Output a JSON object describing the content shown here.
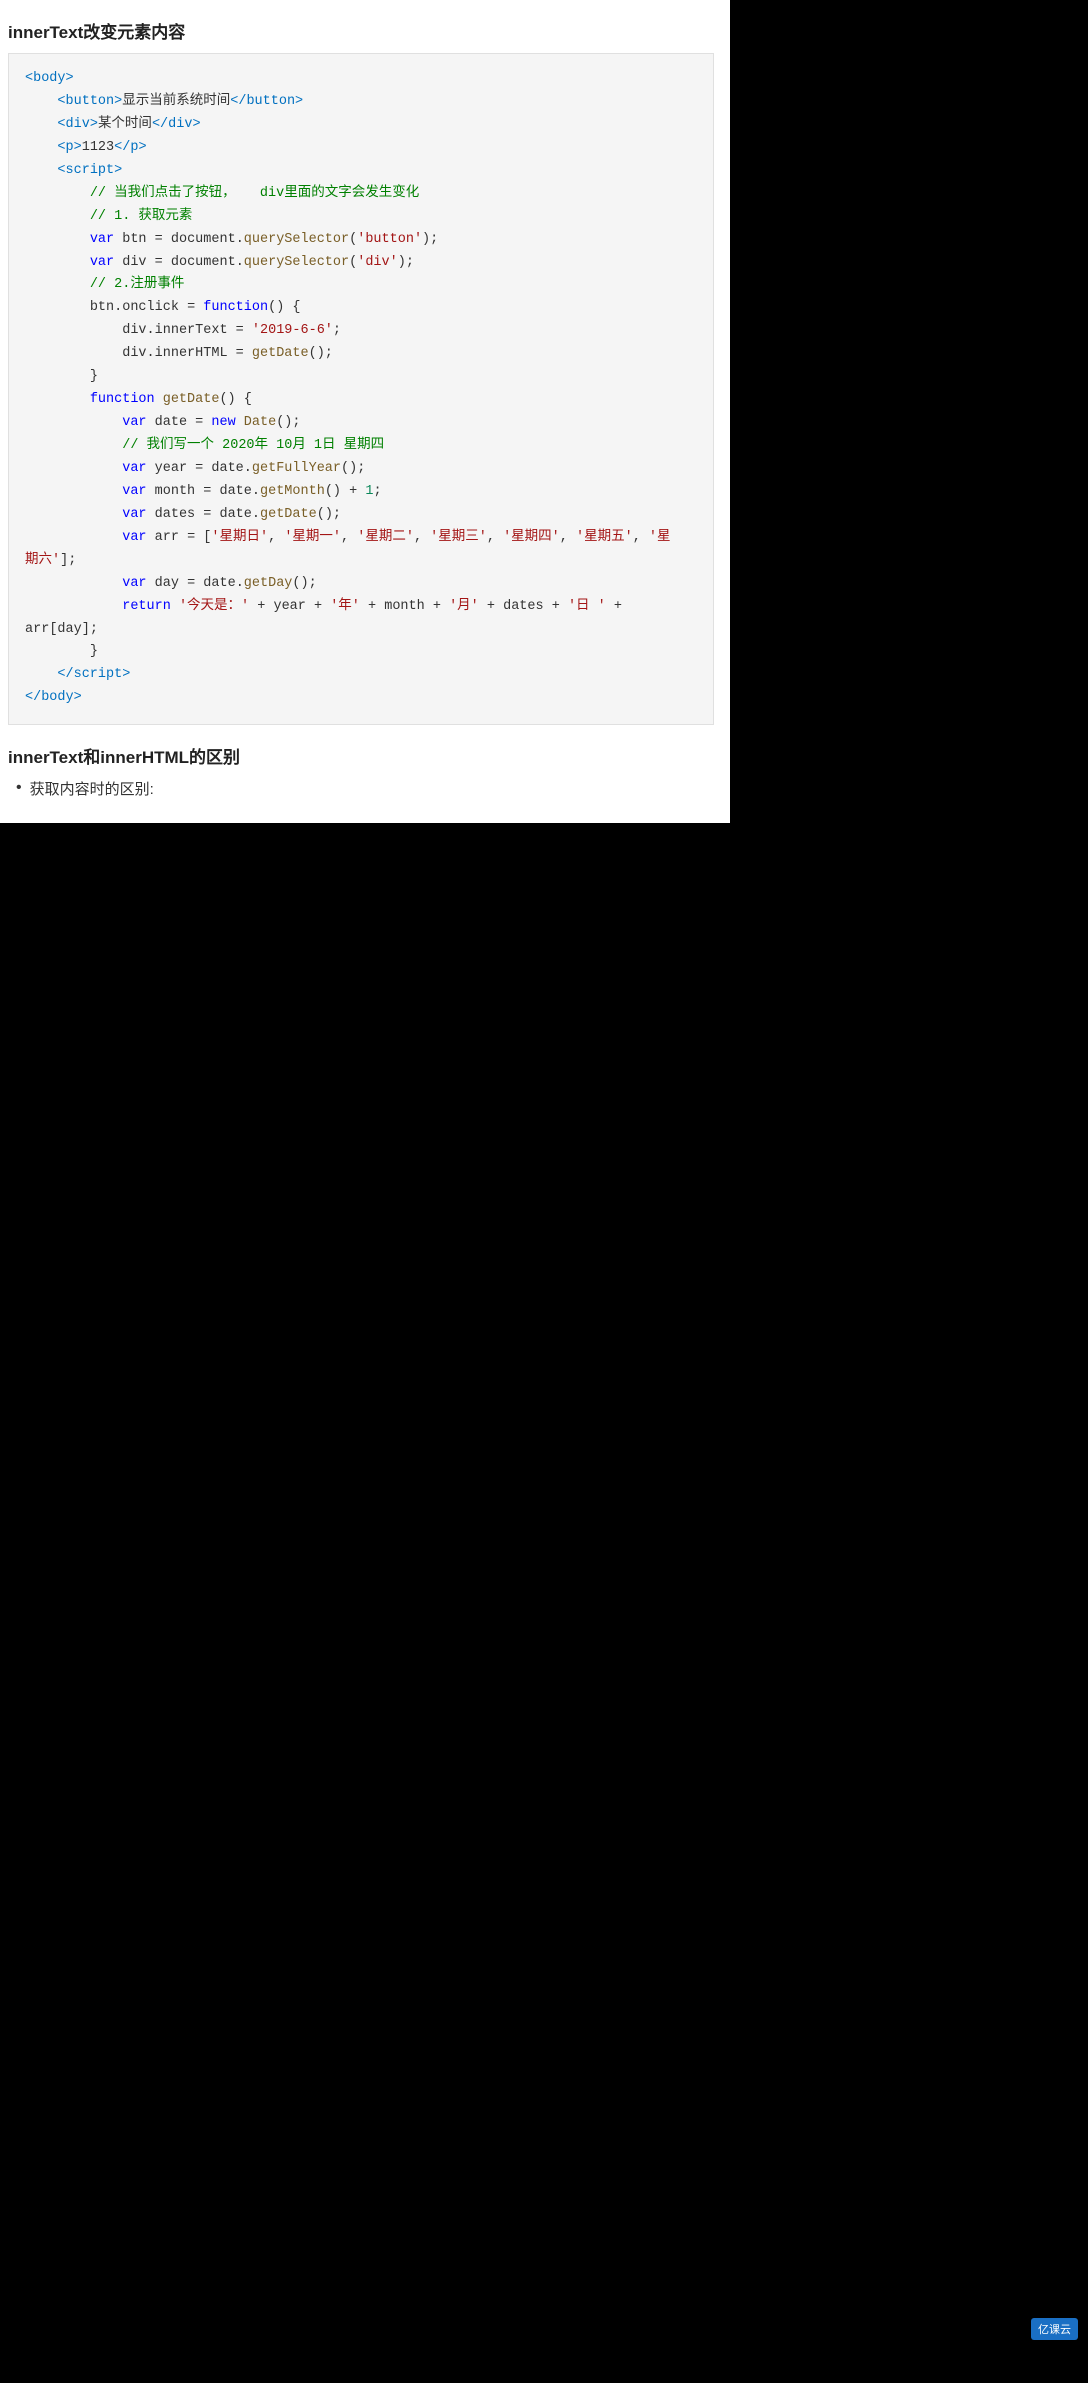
{
  "page": {
    "section1": {
      "title": "innerText改变元素内容"
    },
    "code": {
      "lines": []
    },
    "section2": {
      "title": "innerText和innerHTML的区别"
    },
    "bullet1": {
      "text": "获取内容时的区别:"
    },
    "logo": {
      "text": "亿课云"
    }
  }
}
